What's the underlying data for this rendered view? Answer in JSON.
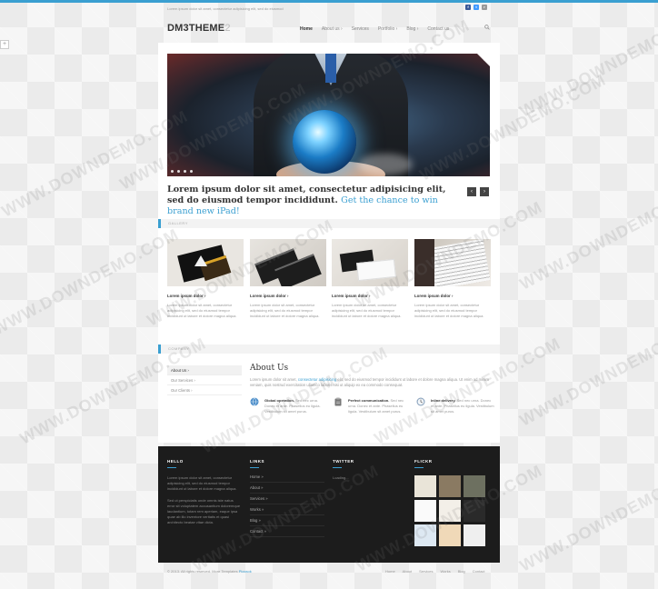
{
  "topbar": {
    "tagline": "Lorem ipsum dolor sit amet, consectetur adipisicing elit, sed do eiusmod",
    "social": [
      {
        "icon": "facebook-icon",
        "glyph": "f",
        "color": "#3b5998"
      },
      {
        "icon": "twitter-icon",
        "glyph": "t",
        "color": "#4099ff"
      },
      {
        "icon": "rss-icon",
        "glyph": "r",
        "color": "#999999"
      }
    ]
  },
  "header": {
    "logo": "DM3THEME",
    "logo_version": "2",
    "nav": [
      "Home",
      "About us",
      "Services",
      "Portfolio",
      "Blog",
      "Contact us"
    ],
    "nav_active": "Home",
    "search_icon": "search-icon"
  },
  "slider": {
    "tagline_main": "Lorem ipsum dolor sit amet, consectetur adipisicing elit, sed do eiusmod tempor incididunt.",
    "tagline_highlight": "Get the chance to win brand new iPad!",
    "prev_glyph": "‹",
    "next_glyph": "›",
    "plus_glyph": "+"
  },
  "gallery": {
    "section_label": "GALLERY",
    "items": [
      {
        "title": "Lorem ipsum dolor",
        "desc": "Lorem ipsum dolor sit amet, consectetur adipisicing elit, sed do eiusmod tempor incididunt ut labore et dolore magna aliqua."
      },
      {
        "title": "Lorem ipsum dolor",
        "desc": "Lorem ipsum dolor sit amet, consectetur adipisicing elit, sed do eiusmod tempor incididunt ut labore et dolore magna aliqua."
      },
      {
        "title": "Lorem ipsum dolor",
        "desc": "Lorem ipsum dolor sit amet, consectetur adipisicing elit, sed do eiusmod tempor incididunt ut labore et dolore magna aliqua."
      },
      {
        "title": "Lorem ipsum dolor",
        "desc": "Lorem ipsum dolor sit amet, consectetur adipisicing elit, sed do eiusmod tempor incididunt ut labore et dolore magna aliqua."
      }
    ]
  },
  "company": {
    "section_label": "COMPANY",
    "sidebar": [
      "About Us",
      "Our Services",
      "Our Clients"
    ],
    "about_title": "About Us",
    "about_text_a": "Lorem ipsum dolor sit amet,",
    "about_text_link": "consectetur adipisicing",
    "about_text_b": "elit, sed do eiusmod tempor incididunt ut labore et dolore magna aliqua. Ut enim ad minim veniam, quis nostrud exercitation ullamco laboris nisi ut aliquip ex ea commodo consequat.",
    "features": [
      {
        "icon": "globe-icon",
        "title": "Global operation.",
        "text": "Sed nec urna. Donec et ante. Phasellus eu ligula. Vestibulum sit amet purus."
      },
      {
        "icon": "clipboard-icon",
        "title": "Perfect communication.",
        "text": "Sed nec urna. Donec et ante. Phasellus eu ligula. Vestibulum sit amet purus."
      },
      {
        "icon": "clock-icon",
        "title": "Inline delivery.",
        "text": "Sed nec urna. Donec et ante. Phasellus eu ligula. Vestibulum sit amet purus."
      }
    ]
  },
  "footer": {
    "hello_head": "HELLO",
    "hello_p1": "Lorem ipsum dolor sit amet, consectetur adipisicing elit, sed do eiusmod tempor incididunt ut labore et dolore magna aliqua.",
    "hello_p2": "Sed ut perspiciatis unde omnis iste natus error sit voluptatem accusantium doloremque laudantium, totam rem aperiam, eaque ipsa quae ab illo inventore veritatis et quasi architecto beatae vitae dicta.",
    "links_head": "LINKS",
    "links": [
      "Home »",
      "About »",
      "Services »",
      "Works »",
      "Blog »",
      "Contact »"
    ],
    "twitter_head": "TWITTER",
    "twitter_text": "Loading...",
    "flickr_head": "FLICKR",
    "flickr_colors": [
      "#e9e4d8",
      "#8a7a62",
      "#6d7060",
      "#fafafa",
      "#f3efe8",
      "#2a2a2a",
      "#dde8f2",
      "#f0d9b8",
      "#efefef"
    ]
  },
  "bottom": {
    "copyright": "© 2013. All rights reserved. More Templates",
    "copyright_link": "Pizzaok",
    "nav": [
      "Home",
      "About",
      "Services",
      "Works",
      "Blog",
      "Contact"
    ]
  },
  "watermark": "WWW.DOWNDEMO.COM"
}
